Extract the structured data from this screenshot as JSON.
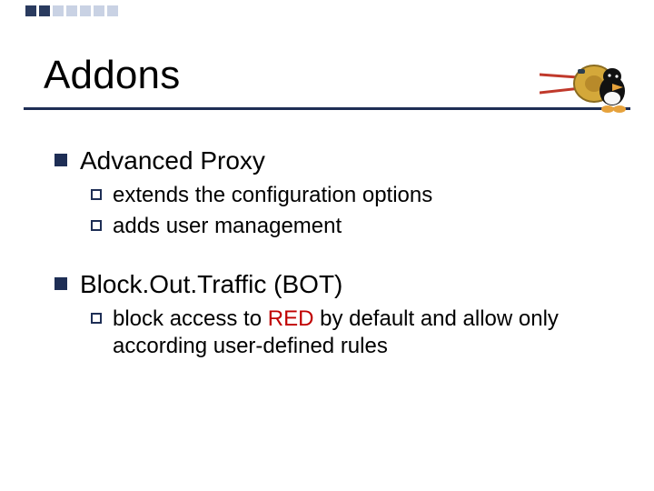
{
  "slide": {
    "title": "Addons",
    "sections": [
      {
        "heading": "Advanced Proxy",
        "items": [
          {
            "text": "extends the configuration options"
          },
          {
            "text": "adds user management"
          }
        ]
      },
      {
        "heading": "Block.Out.Traffic (BOT)",
        "items": [
          {
            "prefix": "block access to ",
            "highlight": "RED",
            "suffix": " by default and allow only according user-defined rules"
          }
        ]
      }
    ]
  },
  "colors": {
    "brand_dark": "#1e2e55",
    "brand_light": "#c9d2e4",
    "highlight_red": "#c00000"
  }
}
